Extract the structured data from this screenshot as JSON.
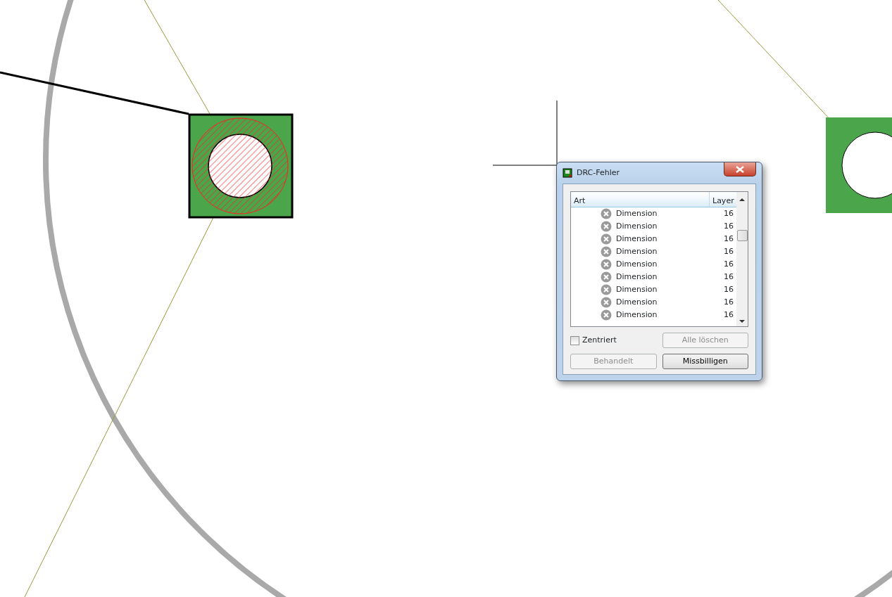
{
  "dialog": {
    "title": "DRC-Fehler",
    "table": {
      "columns": [
        "Art",
        "Layer"
      ],
      "rows": [
        {
          "art": "Dimension",
          "layer": "16"
        },
        {
          "art": "Dimension",
          "layer": "16"
        },
        {
          "art": "Dimension",
          "layer": "16"
        },
        {
          "art": "Dimension",
          "layer": "16"
        },
        {
          "art": "Dimension",
          "layer": "16"
        },
        {
          "art": "Dimension",
          "layer": "16"
        },
        {
          "art": "Dimension",
          "layer": "16"
        },
        {
          "art": "Dimension",
          "layer": "16"
        },
        {
          "art": "Dimension",
          "layer": "16"
        }
      ]
    },
    "checkbox": {
      "label": "Zentriert",
      "checked": false
    },
    "buttons": [
      {
        "label": "Alle löschen",
        "disabled": true
      },
      {
        "label": "Behandelt",
        "disabled": true
      },
      {
        "label": "Missbilligen",
        "disabled": false
      }
    ]
  }
}
